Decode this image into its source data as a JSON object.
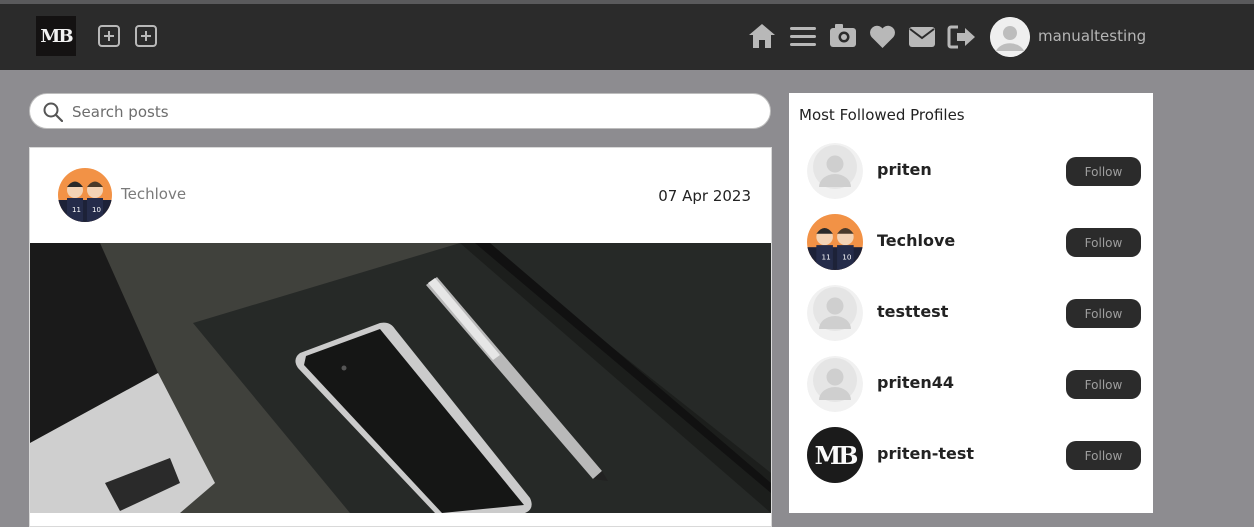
{
  "navbar": {
    "logo_text": "MB",
    "username": "manualtesting",
    "icons": [
      "add-box-icon",
      "add-box-icon",
      "home-icon",
      "menu-icon",
      "camera-icon",
      "heart-icon",
      "mail-icon",
      "logout-icon"
    ]
  },
  "search": {
    "placeholder": "Search posts",
    "value": ""
  },
  "post": {
    "author": "Techlove",
    "date": "07 Apr 2023"
  },
  "sidebar": {
    "title": "Most Followed Profiles",
    "profiles": [
      {
        "name": "priten",
        "button": "Follow",
        "avatar": "default"
      },
      {
        "name": "Techlove",
        "button": "Follow",
        "avatar": "photo"
      },
      {
        "name": "testtest",
        "button": "Follow",
        "avatar": "default"
      },
      {
        "name": "priten44",
        "button": "Follow",
        "avatar": "default"
      },
      {
        "name": "priten-test",
        "button": "Follow",
        "avatar": "MB"
      }
    ]
  },
  "colors": {
    "navbar": "#2b2b2b",
    "page_bg": "#8d8c90",
    "button_bg": "#2b2b2b",
    "icon": "#b8b8b8"
  }
}
